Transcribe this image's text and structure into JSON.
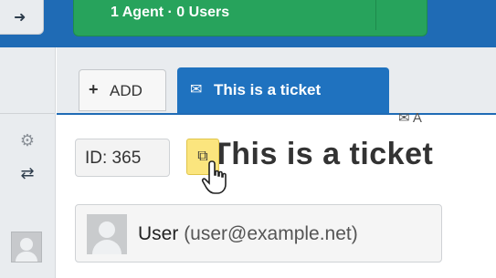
{
  "header": {
    "agent_button_label": "1 Agent · 0 Users"
  },
  "tabs": {
    "add_label": "ADD",
    "ticket_tab_label": "This is a ticket"
  },
  "ticket": {
    "id_label": "ID: 365",
    "title": "This is a ticket"
  },
  "user": {
    "name": "User",
    "email": "(user@example.net)"
  },
  "actions": {
    "mail_link_label": "A"
  },
  "colors": {
    "topbar": "#1f6bb5",
    "agent_button": "#27a35c",
    "active_tab": "#1f72bf",
    "copy_button": "#fbe57e"
  },
  "icons": {
    "sidebar": [
      "gear-icon",
      "retweet-icon",
      "user-avatar-icon"
    ],
    "tabs": [
      "plus-icon",
      "envelope-icon"
    ],
    "ticket": [
      "copy-icon",
      "hand-cursor-icon"
    ],
    "mail": "envelope-outline-icon"
  }
}
